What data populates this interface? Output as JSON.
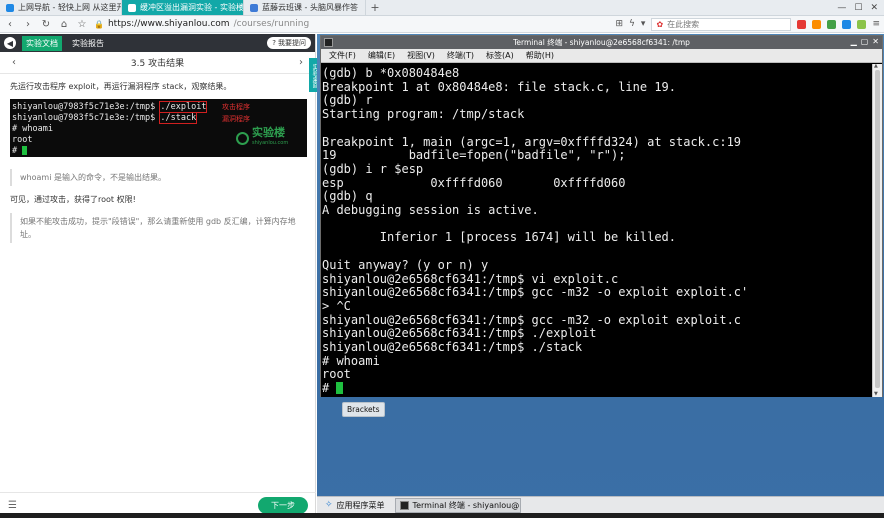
{
  "browser": {
    "tabs": [
      {
        "label": "上网导航 - 轻快上网 从这里开",
        "color": "#1e88e5",
        "active": false
      },
      {
        "label": "缓冲区溢出漏洞实验 - 实验楼",
        "color": "#12a8a8",
        "active": true
      },
      {
        "label": "蓝藤云班课 - 头脑风暴作答",
        "color": "#3f7bd6",
        "active": false
      }
    ],
    "new_tab": "+",
    "close": "×",
    "url_host": "https://www.shiyanlou.com",
    "url_path": "/courses/running",
    "search_placeholder": "在此搜索"
  },
  "lab": {
    "header_tabs": [
      "实验文档",
      "实验报告"
    ],
    "ask_label": "我要提问",
    "chapter_title": "3.5 攻击结果",
    "instruction": "先运行攻击程序 exploit，再运行漏洞程序 stack，观察结果。",
    "shot_lines": [
      {
        "prompt": "shiyanlou@7983f5c71e3e:/tmp$ ",
        "cmd": "./exploit",
        "ann": "攻击程序"
      },
      {
        "prompt": "shiyanlou@7983f5c71e3e:/tmp$ ",
        "cmd": "./stack",
        "ann": "漏洞程序"
      },
      {
        "prompt": "# whoami",
        "cmd": "",
        "ann": ""
      },
      {
        "prompt": "root",
        "cmd": "",
        "ann": ""
      },
      {
        "prompt": "# ",
        "cmd": "",
        "ann": ""
      }
    ],
    "logo_text": "实验楼",
    "logo_sub": "shiyanlou.com",
    "note1": "whoami 是输入的命令，不是输出结果。",
    "result": "可见，通过攻击，获得了root 权限!",
    "note2": "如果不能攻击成功，提示\"段错误\"，那么请重新使用 gdb 反汇编，计算内存地址。",
    "next_label": "下一步",
    "side_strip": "实验桌面"
  },
  "terminal": {
    "title": "Terminal 终端 - shiyanlou@2e6568cf6341: /tmp",
    "menu": [
      "文件(F)",
      "编辑(E)",
      "视图(V)",
      "终端(T)",
      "标签(A)",
      "帮助(H)"
    ],
    "lines": [
      "(gdb) b *0x080484e8",
      "Breakpoint 1 at 0x80484e8: file stack.c, line 19.",
      "(gdb) r",
      "Starting program: /tmp/stack",
      "",
      "Breakpoint 1, main (argc=1, argv=0xffffd324) at stack.c:19",
      "19          badfile=fopen(\"badfile\", \"r\");",
      "(gdb) i r $esp",
      "esp            0xffffd060       0xffffd060",
      "(gdb) q",
      "A debugging session is active.",
      "",
      "        Inferior 1 [process 1674] will be killed.",
      "",
      "Quit anyway? (y or n) y",
      "shiyanlou@2e6568cf6341:/tmp$ vi exploit.c",
      "shiyanlou@2e6568cf6341:/tmp$ gcc -m32 -o exploit exploit.c'",
      "> ^C",
      "shiyanlou@2e6568cf6341:/tmp$ gcc -m32 -o exploit exploit.c",
      "shiyanlou@2e6568cf6341:/tmp$ ./exploit",
      "shiyanlou@2e6568cf6341:/tmp$ ./stack",
      "# whoami",
      "root",
      "# "
    ]
  },
  "desktop": {
    "tooltip": "Brackets",
    "taskbar": {
      "apps_label": "应用程序菜单",
      "window_label": "Terminal 终端 - shiyanlou@..."
    }
  }
}
